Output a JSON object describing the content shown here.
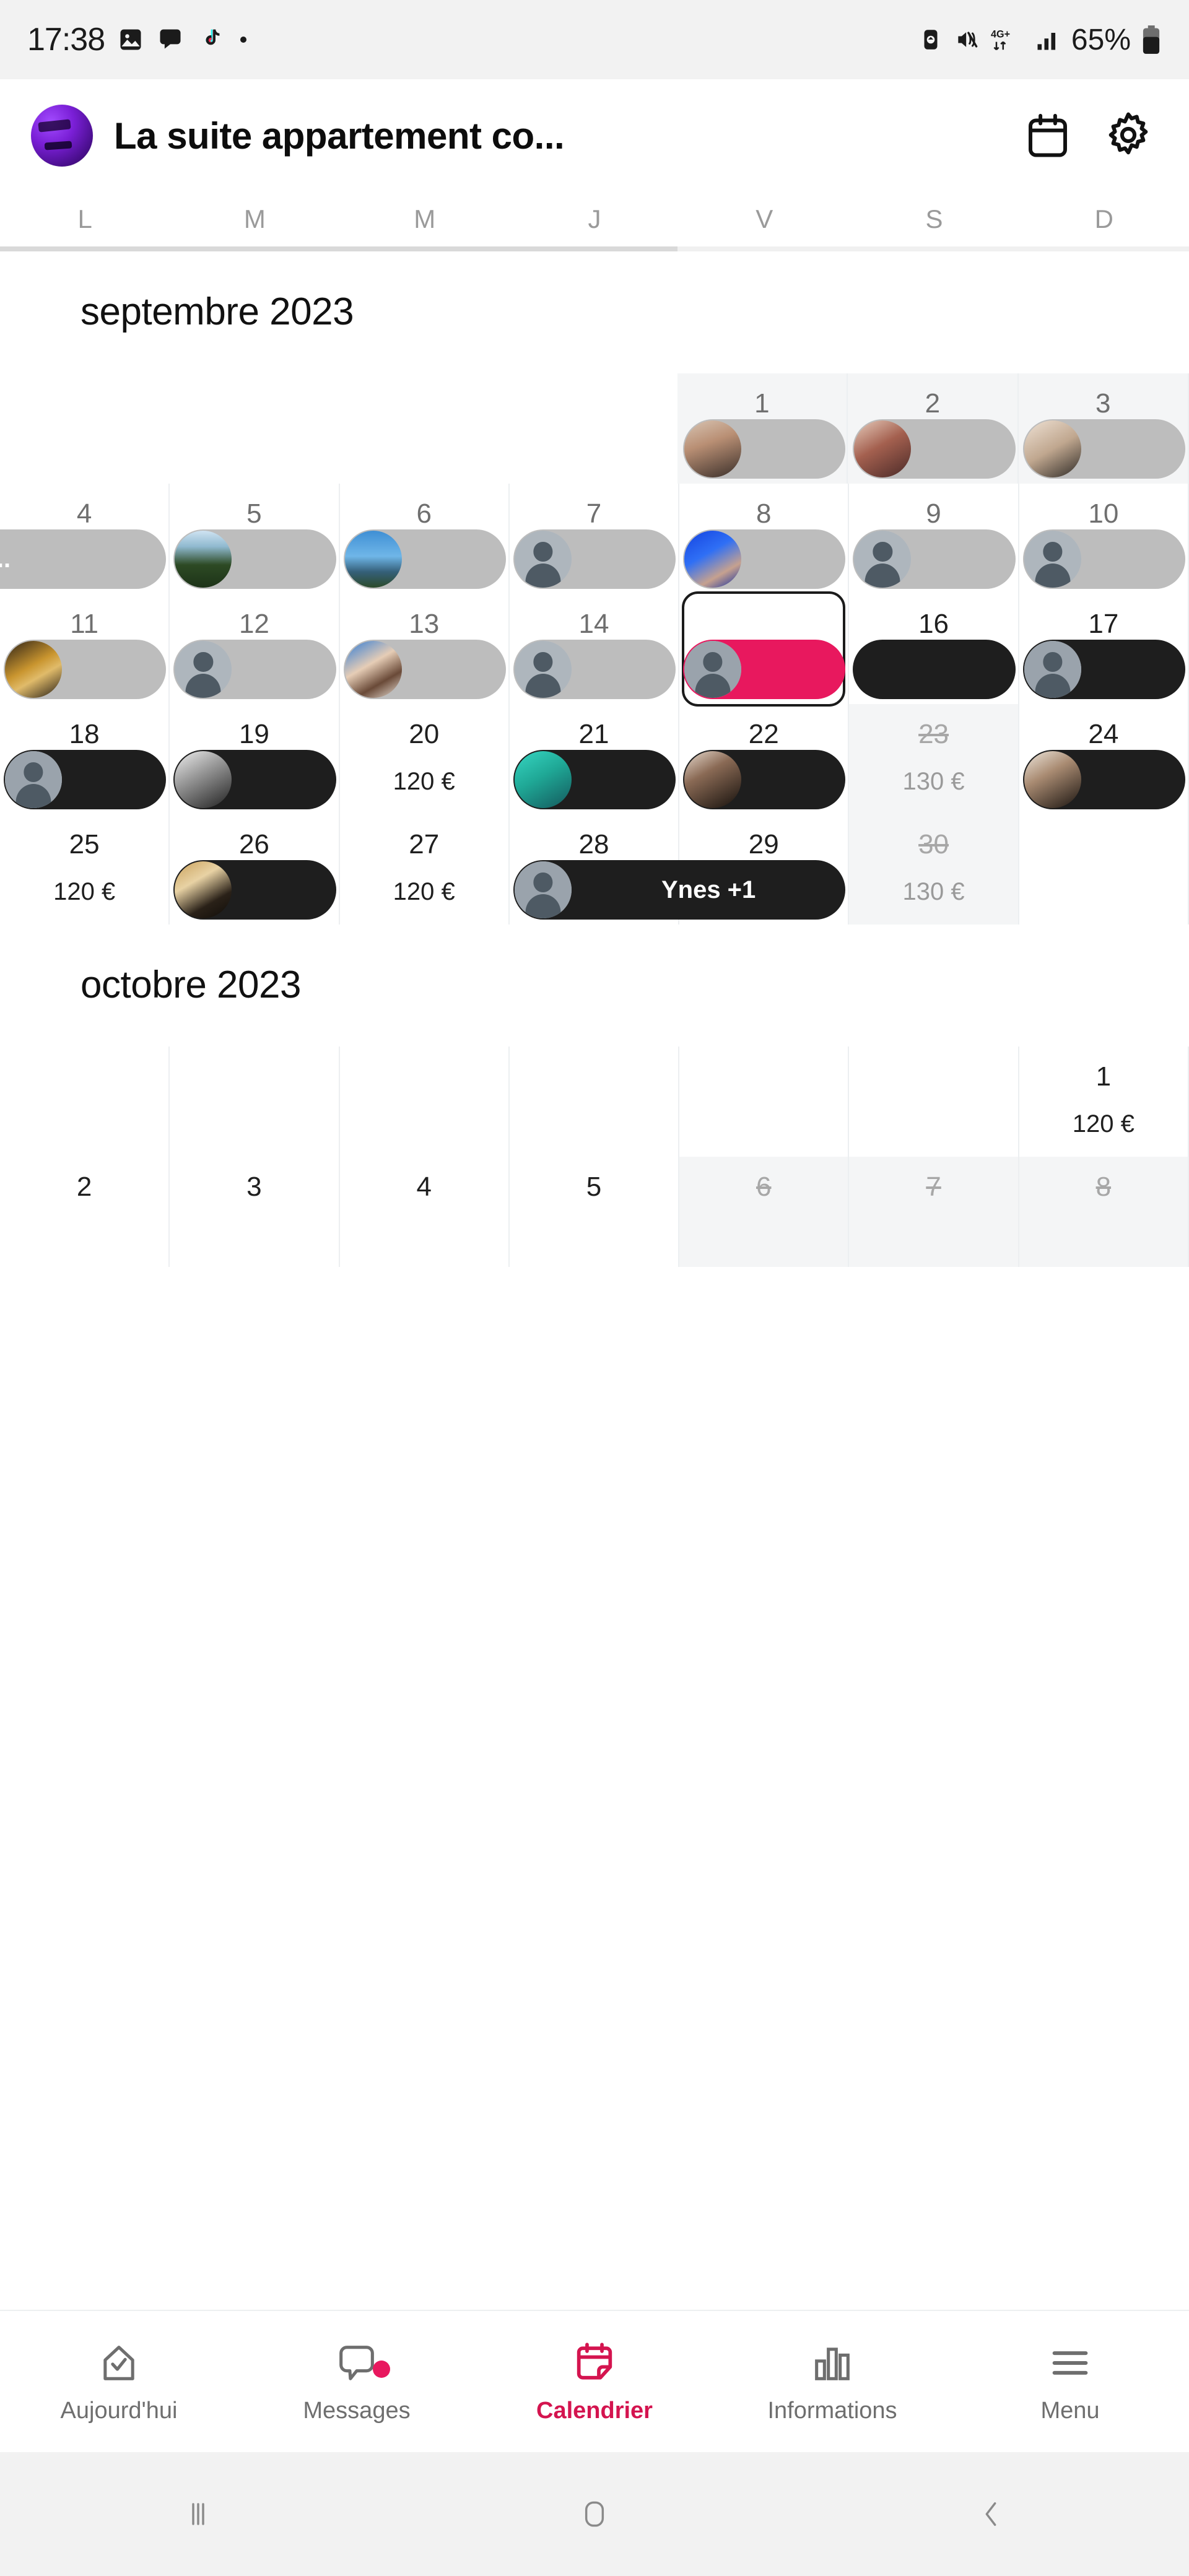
{
  "status_bar": {
    "time": "17:38",
    "battery_percent": "65%",
    "network": "4G+",
    "left_icons": [
      "photos-icon",
      "chat-bubble-icon",
      "tiktok-icon",
      "dot-icon"
    ],
    "right_icons": [
      "alarm-icon",
      "mute-icon",
      "network-4g-icon",
      "signal-bars-icon",
      "battery-icon"
    ]
  },
  "header": {
    "title": "La suite appartement co...",
    "avatar_color": "#7a1fd6",
    "calendar_icon": "calendar-icon",
    "settings_icon": "gear-icon"
  },
  "weekdays": [
    "L",
    "M",
    "M",
    "J",
    "V",
    "S",
    "D"
  ],
  "accent_color": "#d4144f",
  "event_pink": "#e8185e",
  "months": [
    {
      "title": "septembre 2023",
      "weeks": [
        {
          "days": [
            {
              "blank": true
            },
            {
              "blank": true
            },
            {
              "blank": true
            },
            {
              "blank": true
            },
            {
              "num": "1",
              "shaded": true,
              "dim": true,
              "event": {
                "style": "gray",
                "avatar": "photo-woman-1",
                "span": 1,
                "label": ""
              }
            },
            {
              "num": "2",
              "shaded": true,
              "dim": true,
              "event": {
                "style": "gray",
                "avatar": "photo-woman-2",
                "span": 1,
                "label": ""
              }
            },
            {
              "num": "3",
              "shaded": true,
              "dim": true,
              "event": {
                "style": "gray",
                "avatar": "photo-woman-3",
                "span": 1,
                "label": ""
              }
            }
          ]
        },
        {
          "days": [
            {
              "num": "4",
              "dim": true,
              "event": {
                "style": "gray",
                "avatar": "none",
                "span": 1,
                "label": "Matahi ...",
                "continues_left": true
              }
            },
            {
              "num": "5",
              "dim": true,
              "event": {
                "style": "gray",
                "avatar": "photo-landscape-1",
                "span": 1,
                "label": ""
              }
            },
            {
              "num": "6",
              "dim": true,
              "event": {
                "style": "gray",
                "avatar": "photo-landscape-2",
                "span": 1,
                "label": ""
              }
            },
            {
              "num": "7",
              "dim": true,
              "event": {
                "style": "gray",
                "avatar": "default-person",
                "span": 1,
                "label": ""
              }
            },
            {
              "num": "8",
              "dim": true,
              "event": {
                "style": "gray",
                "avatar": "photo-blue",
                "span": 1,
                "label": ""
              }
            },
            {
              "num": "9",
              "dim": true,
              "event": {
                "style": "gray",
                "avatar": "default-person",
                "span": 1,
                "label": ""
              }
            },
            {
              "num": "10",
              "dim": true,
              "event": {
                "style": "gray",
                "avatar": "default-person",
                "span": 1,
                "label": ""
              }
            }
          ]
        },
        {
          "days": [
            {
              "num": "11",
              "dim": true,
              "event": {
                "style": "gray",
                "avatar": "photo-woman-yellow",
                "span": 1,
                "label": ""
              }
            },
            {
              "num": "12",
              "dim": true,
              "event": {
                "style": "gray",
                "avatar": "default-person",
                "span": 1,
                "label": ""
              }
            },
            {
              "num": "13",
              "dim": true,
              "event": {
                "style": "gray",
                "avatar": "photo-man-beard",
                "span": 1,
                "label": ""
              }
            },
            {
              "num": "14",
              "dim": true,
              "event": {
                "style": "gray",
                "avatar": "default-person",
                "span": 1,
                "label": ""
              }
            },
            {
              "num": "15",
              "selected": true,
              "event": {
                "style": "pink",
                "avatar": "default-person",
                "span": 1,
                "label": ""
              }
            },
            {
              "num": "16",
              "event": {
                "style": "dark",
                "avatar": "none",
                "span": 1,
                "label": ""
              }
            },
            {
              "num": "17",
              "event": {
                "style": "dark",
                "avatar": "default-person",
                "span": 1,
                "label": ""
              }
            }
          ]
        },
        {
          "days": [
            {
              "num": "18",
              "event": {
                "style": "dark",
                "avatar": "default-person",
                "span": 1,
                "label": ""
              }
            },
            {
              "num": "19",
              "event": {
                "style": "dark",
                "avatar": "photo-bw",
                "span": 1,
                "label": ""
              }
            },
            {
              "num": "20",
              "price": "120 €"
            },
            {
              "num": "21",
              "event": {
                "style": "dark",
                "avatar": "photo-teal",
                "span": 1,
                "label": ""
              }
            },
            {
              "num": "22",
              "event": {
                "style": "dark",
                "avatar": "photo-woman-4",
                "span": 1,
                "label": ""
              }
            },
            {
              "num": "23",
              "shaded": true,
              "muted": true,
              "price": "130 €"
            },
            {
              "num": "24",
              "event": {
                "style": "dark",
                "avatar": "photo-woman-5",
                "span": 1,
                "label": ""
              }
            }
          ]
        },
        {
          "days": [
            {
              "num": "25",
              "price": "120 €"
            },
            {
              "num": "26",
              "event": {
                "style": "dark",
                "avatar": "photo-man-suit",
                "span": 1,
                "label": ""
              }
            },
            {
              "num": "27",
              "price": "120 €"
            },
            {
              "num": "28",
              "event": {
                "style": "dark",
                "avatar": "default-person",
                "span": 2,
                "label": "Ynes +1"
              }
            },
            {
              "num": "29"
            },
            {
              "num": "30",
              "shaded": true,
              "muted": true,
              "price": "130 €"
            },
            {
              "blank": true
            }
          ]
        }
      ]
    },
    {
      "title": "octobre 2023",
      "weeks": [
        {
          "days": [
            {
              "blank": true
            },
            {
              "blank": true
            },
            {
              "blank": true
            },
            {
              "blank": true
            },
            {
              "blank": true
            },
            {
              "blank": true
            },
            {
              "num": "1",
              "price": "120 €"
            }
          ]
        },
        {
          "days": [
            {
              "num": "2"
            },
            {
              "num": "3"
            },
            {
              "num": "4"
            },
            {
              "num": "5"
            },
            {
              "num": "6",
              "shaded": true,
              "muted": true
            },
            {
              "num": "7",
              "shaded": true,
              "muted": true
            },
            {
              "num": "8",
              "shaded": true,
              "muted": true
            }
          ]
        }
      ]
    }
  ],
  "bottom_nav": [
    {
      "label": "Aujourd'hui",
      "icon": "home-check-icon",
      "active": false,
      "badge": false
    },
    {
      "label": "Messages",
      "icon": "chat-bubble-icon",
      "active": false,
      "badge": true
    },
    {
      "label": "Calendrier",
      "icon": "calendar-note-icon",
      "active": true,
      "badge": false
    },
    {
      "label": "Informations",
      "icon": "bar-chart-icon",
      "active": false,
      "badge": false
    },
    {
      "label": "Menu",
      "icon": "hamburger-icon",
      "active": false,
      "badge": false
    }
  ],
  "system_nav": [
    "recents-icon",
    "home-icon",
    "back-icon"
  ]
}
